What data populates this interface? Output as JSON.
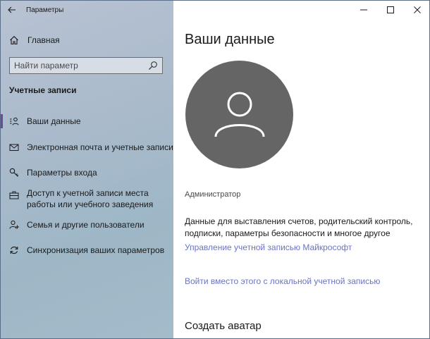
{
  "window": {
    "title": "Параметры"
  },
  "sidebar": {
    "home_label": "Главная",
    "search_placeholder": "Найти параметр",
    "section_title": "Учетные записи",
    "items": [
      {
        "label": "Ваши данные",
        "icon": "person-card-icon",
        "active": true
      },
      {
        "label": "Электронная почта и учетные записи",
        "icon": "mail-icon",
        "active": false
      },
      {
        "label": "Параметры входа",
        "icon": "key-icon",
        "active": false
      },
      {
        "label": "Доступ к учетной записи места работы или учебного заведения",
        "icon": "briefcase-icon",
        "active": false
      },
      {
        "label": "Семья и другие пользователи",
        "icon": "person-add-icon",
        "active": false
      },
      {
        "label": "Синхронизация ваших параметров",
        "icon": "sync-icon",
        "active": false
      }
    ]
  },
  "main": {
    "page_title": "Ваши данные",
    "account_type": "Администратор",
    "description": "Данные для выставления счетов, родительский контроль, подписки, параметры безопасности и многое другое",
    "manage_link": "Управление учетной записью Майкрософт",
    "local_account_link": "Войти вместо этого с локальной учетной записью",
    "create_avatar_title": "Создать аватар"
  },
  "colors": {
    "accent": "#6b4a9e",
    "link": "#6a74c4",
    "avatar_bg": "#656565"
  }
}
